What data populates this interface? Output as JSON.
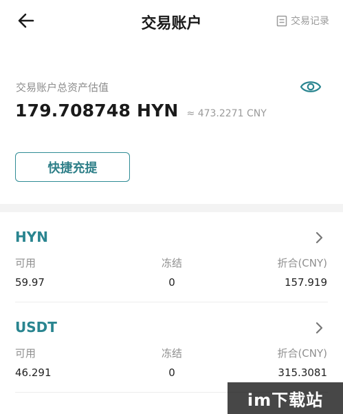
{
  "header": {
    "title": "交易账户",
    "records_label": "交易记录"
  },
  "summary": {
    "label": "交易账户总资产估值",
    "total": "179.708748 HYN",
    "cny_estimate": "≈ 473.2271 CNY",
    "recharge_label": "快捷充提"
  },
  "assets": [
    {
      "name": "HYN",
      "available_label": "可用",
      "frozen_label": "冻结",
      "converted_label": "折合(CNY)",
      "available": "59.97",
      "frozen": "0",
      "converted": "157.919"
    },
    {
      "name": "USDT",
      "available_label": "可用",
      "frozen_label": "冻结",
      "converted_label": "折合(CNY)",
      "available": "46.291",
      "frozen": "0",
      "converted": "315.3081"
    }
  ],
  "watermark": "im下载站",
  "colors": {
    "accent": "#2a8590",
    "muted_text": "#8f8f8f",
    "divider": "#f3f3f3"
  },
  "icons": {
    "back": "arrow-left-icon",
    "records": "document-list-icon",
    "visibility": "eye-icon",
    "navigate": "chevron-right-icon"
  }
}
